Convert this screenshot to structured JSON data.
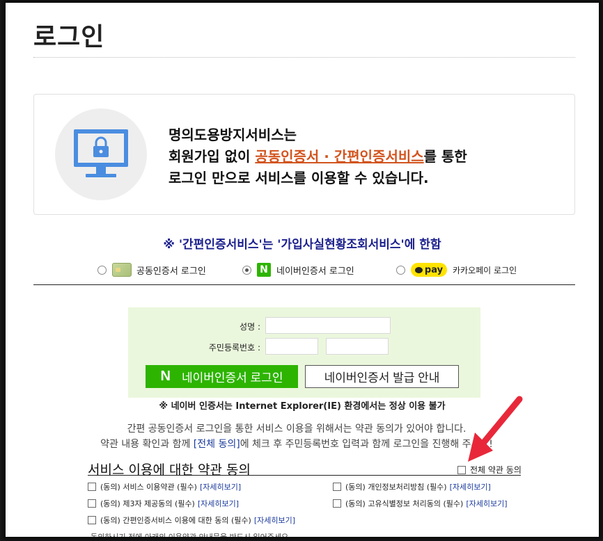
{
  "page": {
    "title": "로그인"
  },
  "info": {
    "line1": "명의도용방지서비스는",
    "line2_pre": "회원가입 없이 ",
    "line2_highlight": "공동인증서 · 간편인증서비스",
    "line2_post": "를 통한",
    "line3": "로그인 만으로 서비스를 이용할 수 있습니다.",
    "icon": "monitor-lock-icon"
  },
  "notice": "※ '간편인증서비스'는 '가입사실현황조회서비스'에 한함",
  "login_options": [
    {
      "label": "공동인증서 로그인",
      "selected": false,
      "icon": "certificate-card-icon"
    },
    {
      "label": "네이버인증서 로그인",
      "selected": true,
      "icon": "naver-icon",
      "icon_text": "N"
    },
    {
      "label": "카카오페이 로그인",
      "selected": false,
      "icon": "kakaopay-icon",
      "icon_text": "pay"
    }
  ],
  "form": {
    "name_label": "성명 :",
    "rrn_label": "주민등록번호 :",
    "naver_button_icon": "N",
    "naver_button": "네이버인증서  로그인",
    "guide_button": "네이버인증서 발급 안내"
  },
  "ie_notice": "※ 네이버 인증서는 Internet Explorer(IE) 환경에서는 정상 이용 불가",
  "terms": {
    "desc_line1": "간편 공동인증서 로그인을 통한 서비스 이용을 위해서는 약관 동의가 있어야 합니다.",
    "desc_line2_pre": "약관 내용 확인과 함께 ",
    "desc_line2_link": "[전체 동의]",
    "desc_line2_post": "에 체크 후 주민등록번호 입력과 함께 로그인을 진행해 주세요!",
    "title": "서비스 이용에 대한 약관 동의",
    "agree_all": "전체 약관 동의",
    "items": [
      {
        "label": "(동의) 서비스 이용약관 (필수)",
        "link": "[자세히보기]"
      },
      {
        "label": "(동의) 개인정보처리방침 (필수)",
        "link": "[자세히보기]"
      },
      {
        "label": "(동의) 제3자 제공동의 (필수)",
        "link": "[자세히보기]"
      },
      {
        "label": "(동의) 고유식별정보 처리동의 (필수)",
        "link": "[자세히보기]"
      },
      {
        "label": "(동의) 간편인증서비스 이용에 대한 동의 (필수)",
        "link": "[자세히보기]"
      }
    ],
    "cut_text": "동의하시기 전에 아래의 이용약관 안내문을 반드시 읽어주세요."
  },
  "colors": {
    "accent_orange": "#d2541e",
    "notice_navy": "#1a1f8c",
    "naver_green": "#2db400",
    "arrow_red": "#e8283a",
    "kakao_yellow": "#ffe300"
  }
}
